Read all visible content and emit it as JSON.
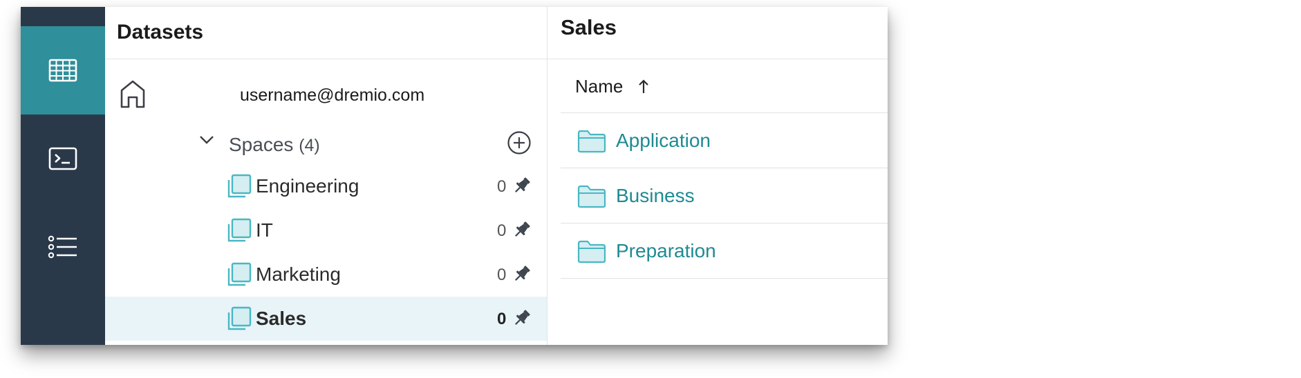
{
  "nav": {
    "items": [
      {
        "icon": "table-grid-icon",
        "active": true
      },
      {
        "icon": "terminal-icon",
        "active": false
      },
      {
        "icon": "list-icon",
        "active": false
      }
    ]
  },
  "datasets_panel": {
    "title": "Datasets",
    "home": {
      "label": "username@dremio.com",
      "icon": "home-icon"
    },
    "spaces": {
      "label": "Spaces",
      "count": "(4)",
      "items": [
        {
          "name": "Engineering",
          "count": "0",
          "selected": false
        },
        {
          "name": "IT",
          "count": "0",
          "selected": false
        },
        {
          "name": "Marketing",
          "count": "0",
          "selected": false
        },
        {
          "name": "Sales",
          "count": "0",
          "selected": true
        }
      ]
    }
  },
  "contents_panel": {
    "title": "Sales",
    "column_header": "Name",
    "sort_indicator": "↑",
    "folders": [
      {
        "name": "Application"
      },
      {
        "name": "Business"
      },
      {
        "name": "Preparation"
      }
    ]
  },
  "colors": {
    "rail": "#2a394a",
    "rail_active": "#2f8f9a",
    "accent": "#1f8a93",
    "selected_row": "#e8f4f8",
    "icon_teal": "#48b7c3"
  }
}
